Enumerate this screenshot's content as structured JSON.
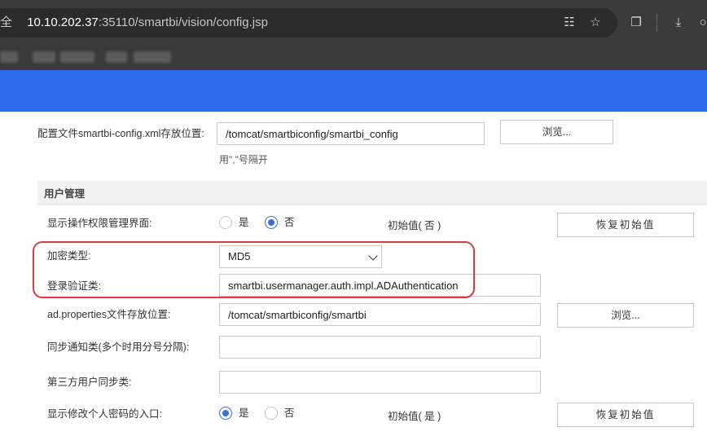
{
  "browser": {
    "url_prefix": "全",
    "url_host": "10.10.202.37",
    "url_rest": ":35110/smartbi/vision/config.jsp",
    "icons": [
      "translate-icon",
      "star-icon",
      "extensions-icon",
      "download-icon"
    ]
  },
  "colors": {
    "header_blue": "#2d6bea",
    "radio_accent": "#3a6fe0",
    "highlight_red": "#e0383c"
  },
  "config_file": {
    "label": "配置文件smartbi-config.xml存放位置:",
    "value": "/tomcat/smartbiconfig/smartbi_config",
    "browse_label": "浏览...",
    "hint": "用\",\"号隔开"
  },
  "section_title": "用户管理",
  "rows": {
    "show_permission_ui": {
      "label": "显示操作权限管理界面:",
      "yes": "是",
      "no": "否",
      "selected": "否",
      "initial": "初始值( 否 )",
      "reset_label": "恢复初始值"
    },
    "encryption_type": {
      "label": "加密类型:",
      "value": "MD5"
    },
    "login_auth_class": {
      "label": "登录验证类:",
      "value": "smartbi.usermanager.auth.impl.ADAuthentication"
    },
    "ad_properties": {
      "label": "ad.properties文件存放位置:",
      "value": "/tomcat/smartbiconfig/smartbi",
      "browse_label": "浏览..."
    },
    "sync_notify": {
      "label": "同步通知类(多个时用分号分隔):",
      "value": ""
    },
    "third_party_sync": {
      "label": "第三方用户同步类:",
      "value": ""
    },
    "show_change_password": {
      "label": "显示修改个人密码的入口:",
      "yes": "是",
      "no": "否",
      "selected": "是",
      "initial": "初始值( 是 )",
      "reset_label": "恢复初始值"
    }
  }
}
